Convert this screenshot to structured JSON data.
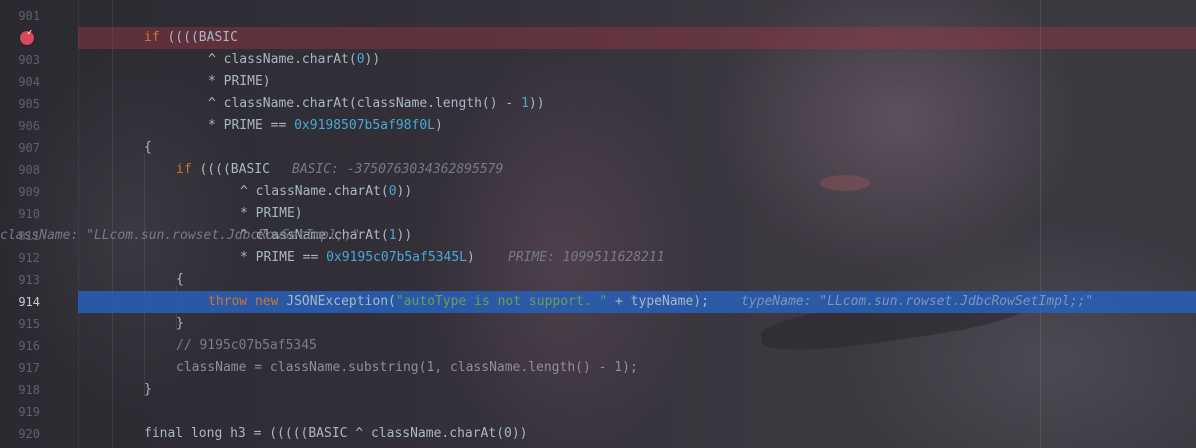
{
  "editor": {
    "lines": [
      {
        "num": "901",
        "segments": [],
        "inline": ""
      },
      {
        "num": "",
        "breakpoint": true,
        "segments": [
          {
            "t": "if",
            "c": "kw"
          },
          {
            "t": " ((((BASIC"
          }
        ],
        "inline": ""
      },
      {
        "num": "903",
        "segments": [
          {
            "t": "^ className.charAt("
          },
          {
            "t": "0",
            "c": "num"
          },
          {
            "t": "))"
          }
        ],
        "inline": ""
      },
      {
        "num": "904",
        "segments": [
          {
            "t": "* PRIME)"
          }
        ],
        "inline": ""
      },
      {
        "num": "905",
        "segments": [
          {
            "t": "^ className.charAt(className.length() - "
          },
          {
            "t": "1",
            "c": "num"
          },
          {
            "t": "))"
          }
        ],
        "inline": ""
      },
      {
        "num": "906",
        "segments": [
          {
            "t": "* PRIME == "
          },
          {
            "t": "0x9198507b5af98f0L",
            "c": "num"
          },
          {
            "t": ")"
          }
        ],
        "inline": ""
      },
      {
        "num": "907",
        "segments": [
          {
            "t": "{"
          }
        ],
        "inline": ""
      },
      {
        "num": "908",
        "segments": [
          {
            "t": "if",
            "c": "kw"
          },
          {
            "t": " ((((BASIC"
          }
        ],
        "inline": "BASIC: -3750763034362895579"
      },
      {
        "num": "909",
        "segments": [
          {
            "t": "^ className.charAt("
          },
          {
            "t": "0",
            "c": "num"
          },
          {
            "t": "))"
          }
        ],
        "inline": ""
      },
      {
        "num": "910",
        "segments": [
          {
            "t": "* PRIME)"
          }
        ],
        "inline": ""
      },
      {
        "num": "911",
        "segments": [
          {
            "t": "^ className.charAt("
          },
          {
            "t": "1",
            "c": "num"
          },
          {
            "t": "))"
          }
        ],
        "inline": "className: \"LLcom.sun.rowset.JdbcRowSetImpl;;\""
      },
      {
        "num": "912",
        "segments": [
          {
            "t": "* PRIME == "
          },
          {
            "t": "0x9195c07b5af5345L",
            "c": "num"
          },
          {
            "t": ")"
          }
        ],
        "inline": "PRIME: 1099511628211"
      },
      {
        "num": "913",
        "segments": [
          {
            "t": "{"
          }
        ],
        "inline": ""
      },
      {
        "num": "914",
        "current": true,
        "segments": [
          {
            "t": "throw new",
            "c": "kw"
          },
          {
            "t": " JSONException("
          },
          {
            "t": "\"autoType is not support. \"",
            "c": "str"
          },
          {
            "t": " + typeName);"
          }
        ],
        "inline": "typeName: \"LLcom.sun.rowset.JdbcRowSetImpl;;\""
      },
      {
        "num": "915",
        "segments": [
          {
            "t": "}"
          }
        ],
        "inline": ""
      },
      {
        "num": "916",
        "segments": [
          {
            "t": "// 9195c07b5af5345",
            "c": "cmt"
          }
        ],
        "inline": ""
      },
      {
        "num": "917",
        "segments": [
          {
            "t": "className = className.substring(1, className.length() - 1);",
            "c": "dim"
          }
        ],
        "inline": ""
      },
      {
        "num": "918",
        "segments": [
          {
            "t": "}"
          }
        ],
        "inline": ""
      },
      {
        "num": "919",
        "segments": [],
        "inline": ""
      },
      {
        "num": "920",
        "segments": [
          {
            "t": "final long h3 = (((((BASIC ^ className.charAt(0))"
          }
        ],
        "inline": ""
      }
    ]
  }
}
